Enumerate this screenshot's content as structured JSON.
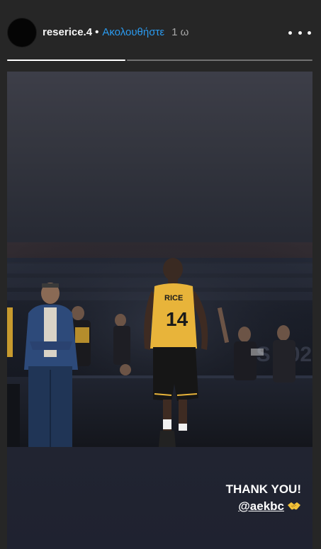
{
  "header": {
    "username": "reserice.4",
    "separator": "•",
    "follow_label": "Ακολουθήστε",
    "time": "1 ω",
    "more_icon": "more-horizontal-icon"
  },
  "progress": {
    "segments": [
      {
        "fill": 1.0
      },
      {
        "fill": 0.0
      }
    ]
  },
  "story": {
    "caption_line1": "THANK YOU!",
    "mention": "@aekbc",
    "emoji_icon": "handshake-icon",
    "photo": {
      "jersey_name": "RICE",
      "jersey_number": "14"
    }
  },
  "colors": {
    "background": "#262626",
    "link_blue": "#2b9bf0",
    "jersey_yellow": "#e8b43a"
  }
}
